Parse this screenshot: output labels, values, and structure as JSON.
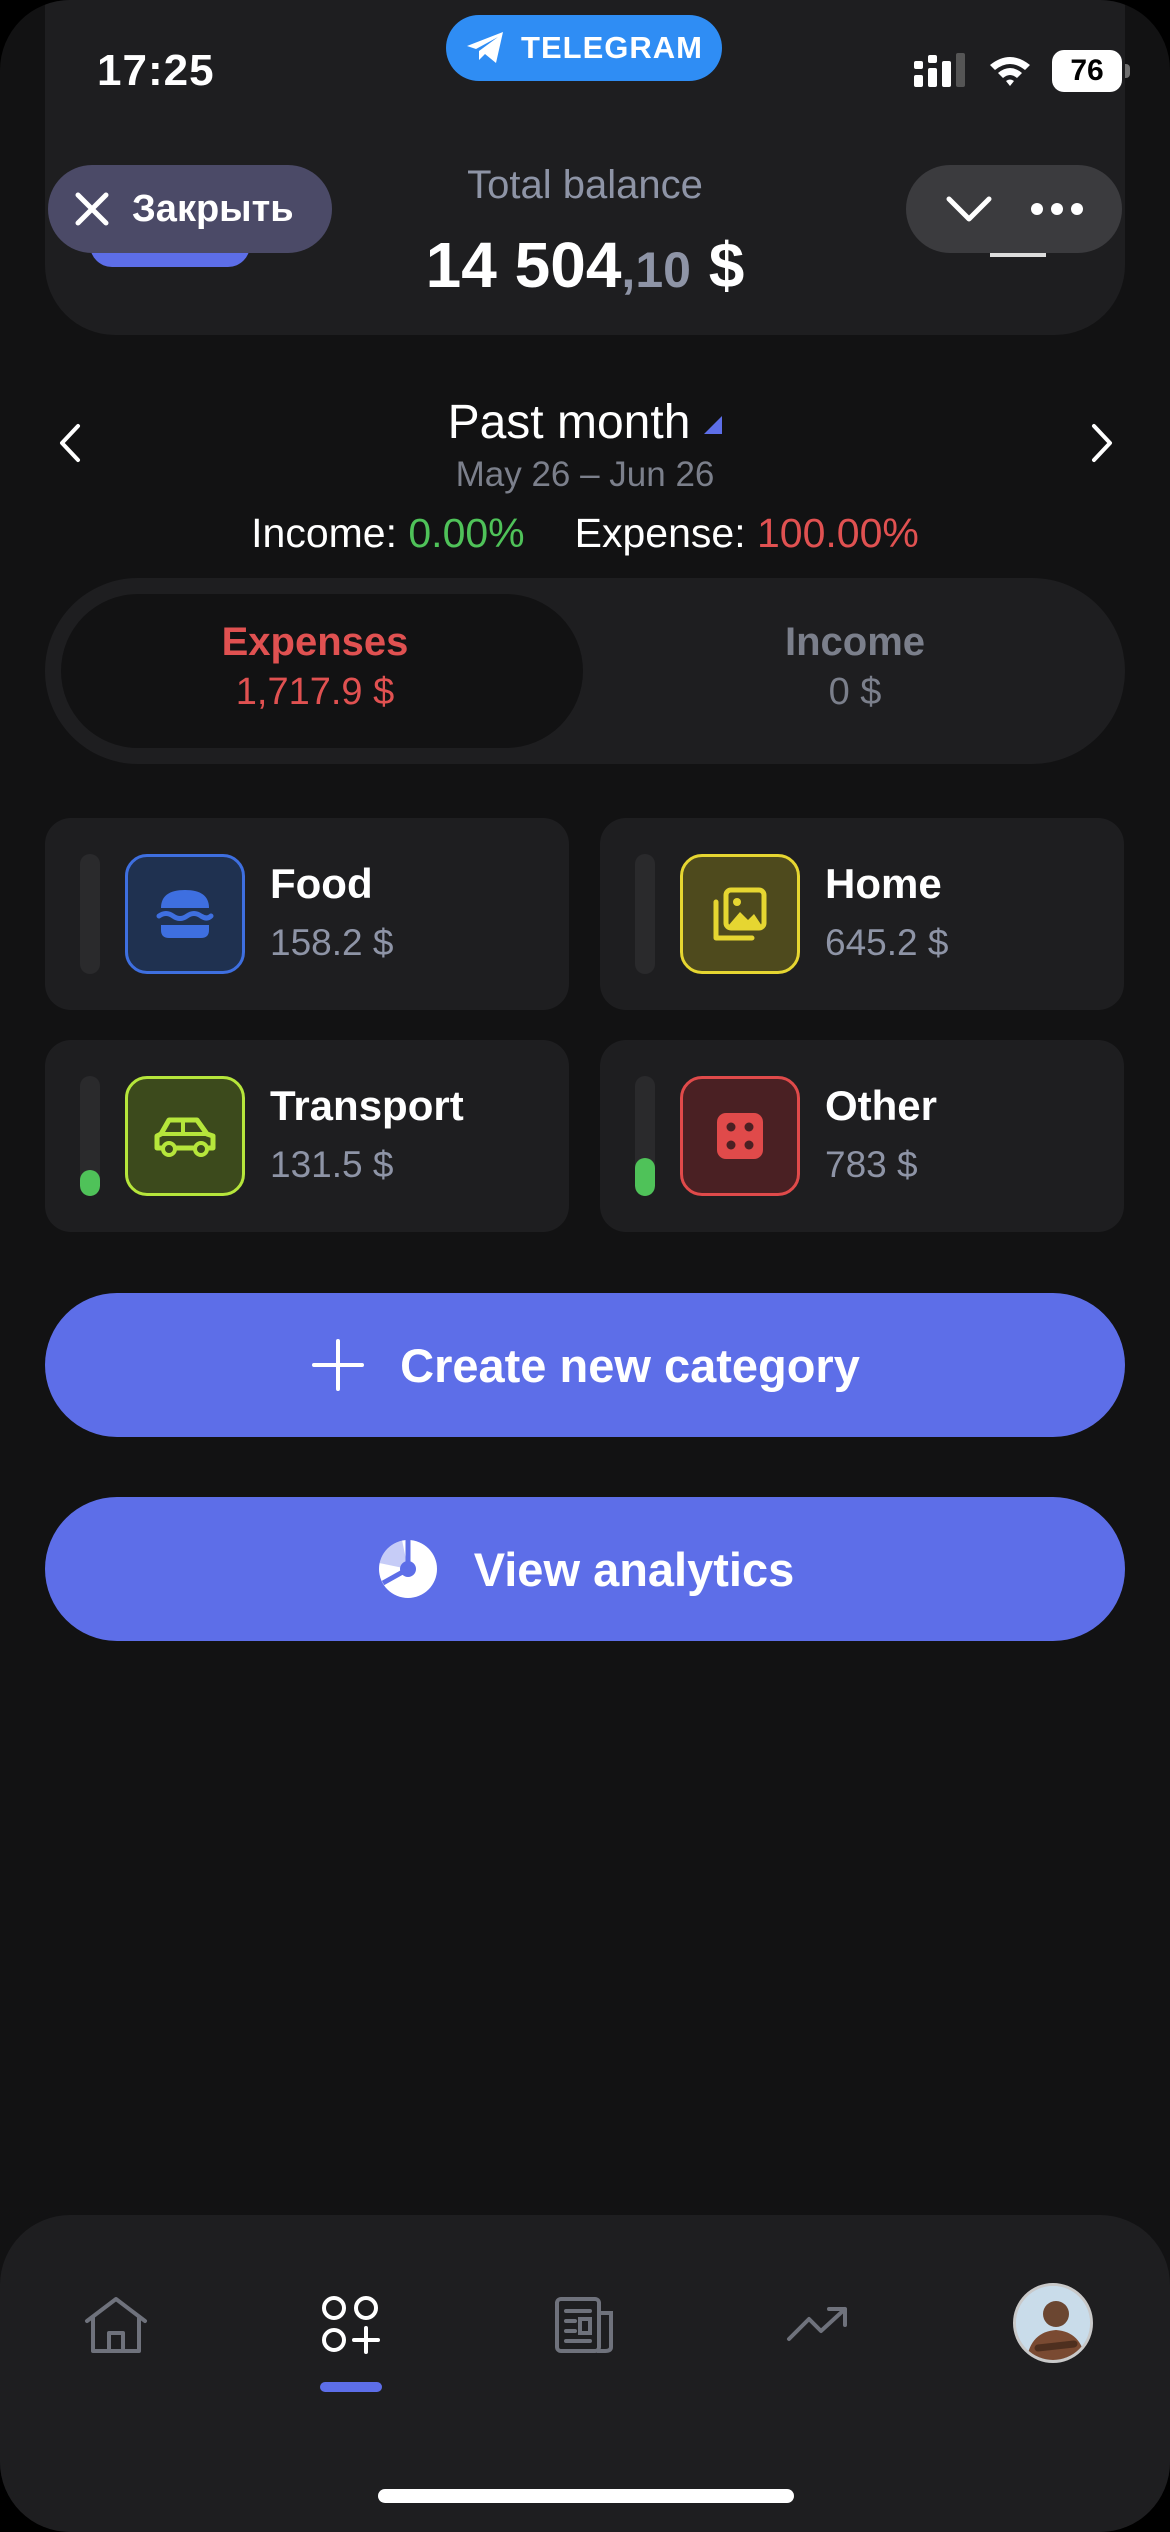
{
  "status_bar": {
    "time": "17:25",
    "battery": "76"
  },
  "telegram": {
    "label": "TELEGRAM"
  },
  "header": {
    "close_label": "Закрыть",
    "balance_label": "Total balance",
    "balance_main": "14 504",
    "balance_cents": ",10",
    "balance_currency": " $"
  },
  "period": {
    "title": "Past month",
    "range": "May 26 – Jun 26",
    "income_label": "Income: ",
    "income_pct": "0.00%",
    "expense_label": "Expense: ",
    "expense_pct": "100.00%"
  },
  "segment": {
    "expenses_label": "Expenses",
    "expenses_value": "1,717.9 $",
    "income_label": "Income",
    "income_value": "0 $"
  },
  "categories": [
    {
      "name": "Food",
      "amount": "158.2 $",
      "icon": "burger-icon",
      "color": "#3e6fe0",
      "bg": "#1f3150",
      "share": 0.0
    },
    {
      "name": "Home",
      "amount": "645.2 $",
      "icon": "image-icon",
      "color": "#e6d631",
      "bg": "#4e4a1d",
      "share": 0.0
    },
    {
      "name": "Transport",
      "amount": "131.5 $",
      "icon": "car-icon",
      "color": "#b6e63b",
      "bg": "#3c4a1c",
      "share": 0.22
    },
    {
      "name": "Other",
      "amount": "783 $",
      "icon": "dice-icon",
      "color": "#e04a4a",
      "bg": "#4a2023",
      "share": 0.32
    }
  ],
  "actions": {
    "create_label": "Create new category",
    "analytics_label": "View analytics"
  },
  "tabs": [
    "home-icon",
    "categories-icon",
    "news-icon",
    "trend-icon",
    "avatar"
  ],
  "colors": {
    "accent": "#5d6ee8",
    "green": "#4fc259",
    "red": "#e05151"
  }
}
